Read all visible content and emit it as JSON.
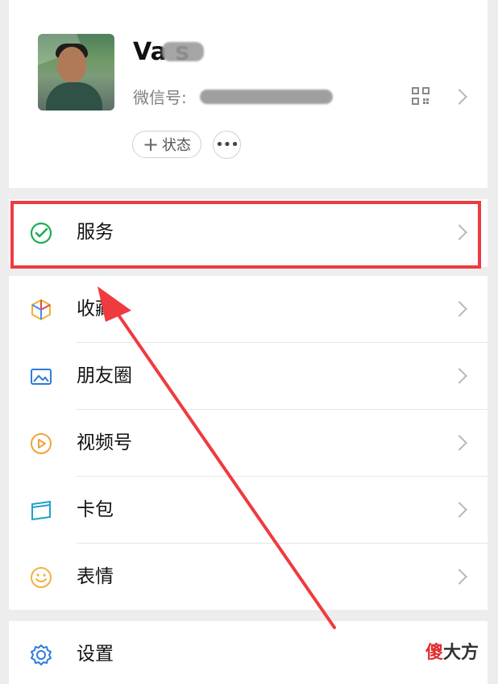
{
  "profile": {
    "name": "Va    s",
    "wechat_id_label": "微信号:",
    "status_label": "状态",
    "qr_icon": "qr-code-icon",
    "chevron_icon": "chevron-right-icon",
    "more_icon": "more-dots-icon"
  },
  "service": {
    "label": "服务",
    "icon": "service-icon",
    "highlight_color": "#ef3a3f"
  },
  "items": [
    {
      "label": "收藏",
      "icon": "favorites-icon"
    },
    {
      "label": "朋友圈",
      "icon": "moments-icon"
    },
    {
      "label": "视频号",
      "icon": "channels-icon"
    },
    {
      "label": "卡包",
      "icon": "cards-icon"
    },
    {
      "label": "表情",
      "icon": "stickers-icon"
    }
  ],
  "settings": {
    "label": "设置",
    "icon": "settings-gear-icon"
  },
  "watermark": {
    "text1": "傻",
    "text2": "大方"
  },
  "arrow": {
    "color": "#ef3a3f",
    "target": "service"
  }
}
